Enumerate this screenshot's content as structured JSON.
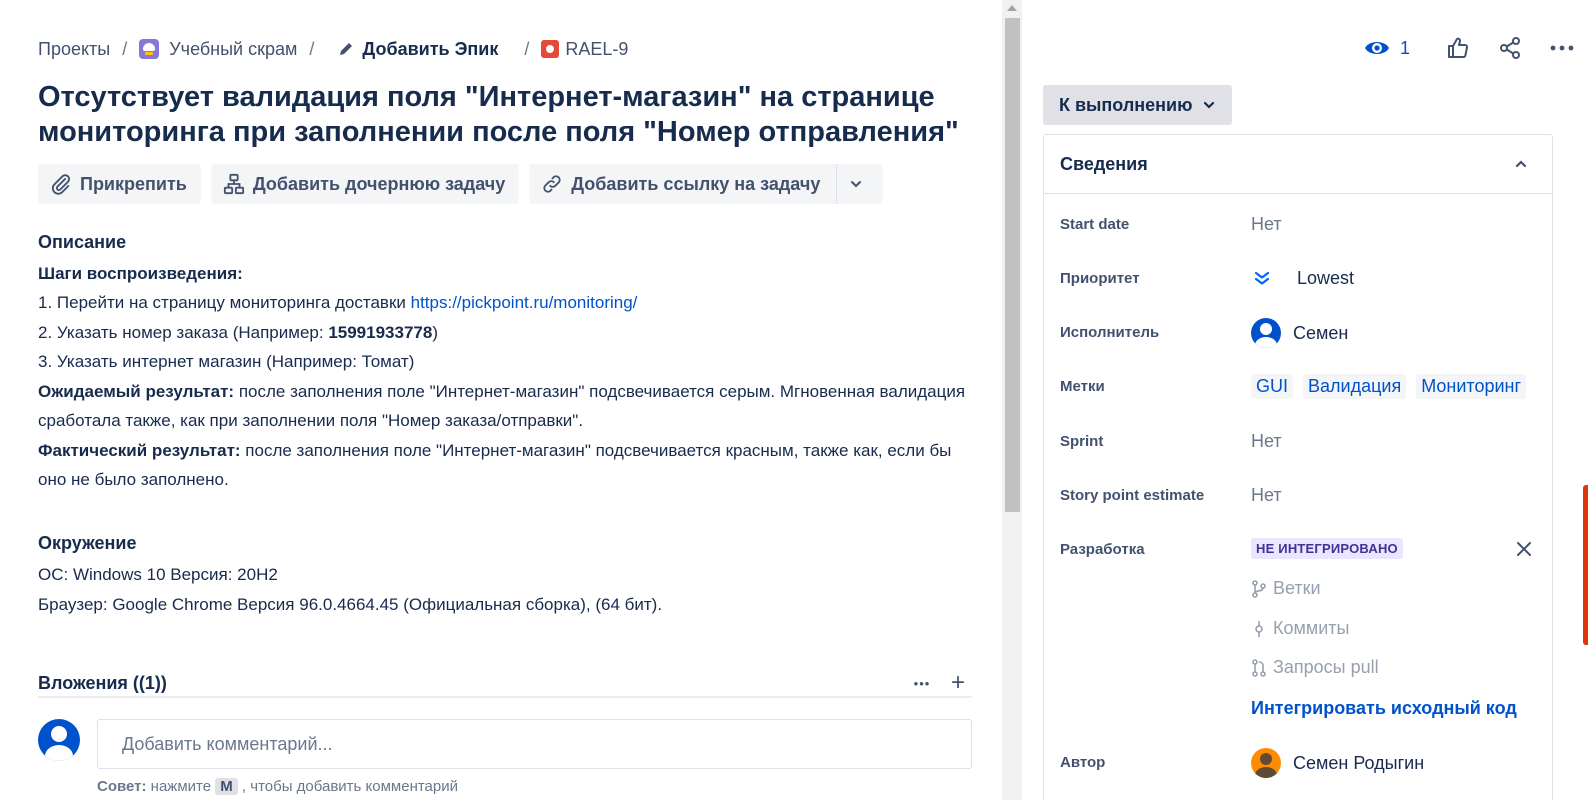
{
  "breadcrumb": {
    "projects": "Проекты",
    "project": "Учебный скрам",
    "add_epic": "Добавить Эпик",
    "issue_key": "RAEL-9",
    "separator": "/"
  },
  "issue": {
    "title": "Отсутствует валидация поля \"Интернет-магазин\" на странице мониторинга при заполнении после поля \"Номер отправления\""
  },
  "actions": {
    "attach": "Прикрепить",
    "add_child": "Добавить дочернюю задачу",
    "add_link": "Добавить ссылку на задачу"
  },
  "description": {
    "heading": "Описание",
    "steps_heading": "Шаги воспроизведения:",
    "step1_text": "1. Перейти на страницу мониторинга доставки ",
    "step1_link": "https://pickpoint.ru/monitoring/",
    "step2_text": "2. Указать номер заказа (Например:  ",
    "step2_number": "15991933778",
    "step2_close": ")",
    "step3_text": "3. Указать интернет магазин (Например: Томат)",
    "expected_label": "Ожидаемый результат:",
    "expected_text": " после заполнения поле \"Интернет-магазин\" подсвечивается серым. Мгновенная валидация сработала также, как при заполнении поля \"Номер заказа/отправки\".",
    "actual_label": "Фактический результат:",
    "actual_text": " после заполнения поле \"Интернет-магазин\" подсвечивается красным, также как, если бы оно не было заполнено."
  },
  "environment": {
    "heading": "Окружение",
    "os": "ОС: Windows 10 Версия: 20H2",
    "browser": "Браузер: Google Chrome Версия 96.0.4664.45 (Официальная сборка), (64 бит)."
  },
  "attachments": {
    "title": "Вложения ((1))",
    "more": "•••",
    "add": "+"
  },
  "comment": {
    "placeholder": "Добавить комментарий...",
    "tip_label": "Совет:",
    "tip_pre": " нажмите ",
    "tip_key": "M",
    "tip_post": " , чтобы добавить комментарий"
  },
  "top_actions": {
    "watch_count": "1"
  },
  "status": {
    "label": "К выполнению"
  },
  "details": {
    "title": "Сведения",
    "start_date_label": "Start date",
    "start_date_value": "Нет",
    "priority_label": "Приоритет",
    "priority_value": "Lowest",
    "assignee_label": "Исполнитель",
    "assignee_value": "Семен",
    "labels_label": "Метки",
    "labels": [
      "GUI",
      "Валидация",
      "Мониторинг"
    ],
    "sprint_label": "Sprint",
    "sprint_value": "Нет",
    "story_points_label": "Story point estimate",
    "story_points_value": "Нет",
    "development_label": "Разработка",
    "development_badge": "НЕ ИНТЕГРИРОВАНО",
    "branches": "Ветки",
    "commits": "Коммиты",
    "pull_requests": "Запросы pull",
    "integrate": "Интегрировать исходный код",
    "reporter_label": "Автор",
    "reporter_value": "Семен Родыгин"
  },
  "colors": {
    "link": "#0052cc",
    "text": "#172b4d",
    "muted": "#6b778c",
    "badge_bg": "#eae6ff",
    "badge_text": "#403294",
    "issue_icon": "#e5493a",
    "project_icon": "#8777d9"
  }
}
